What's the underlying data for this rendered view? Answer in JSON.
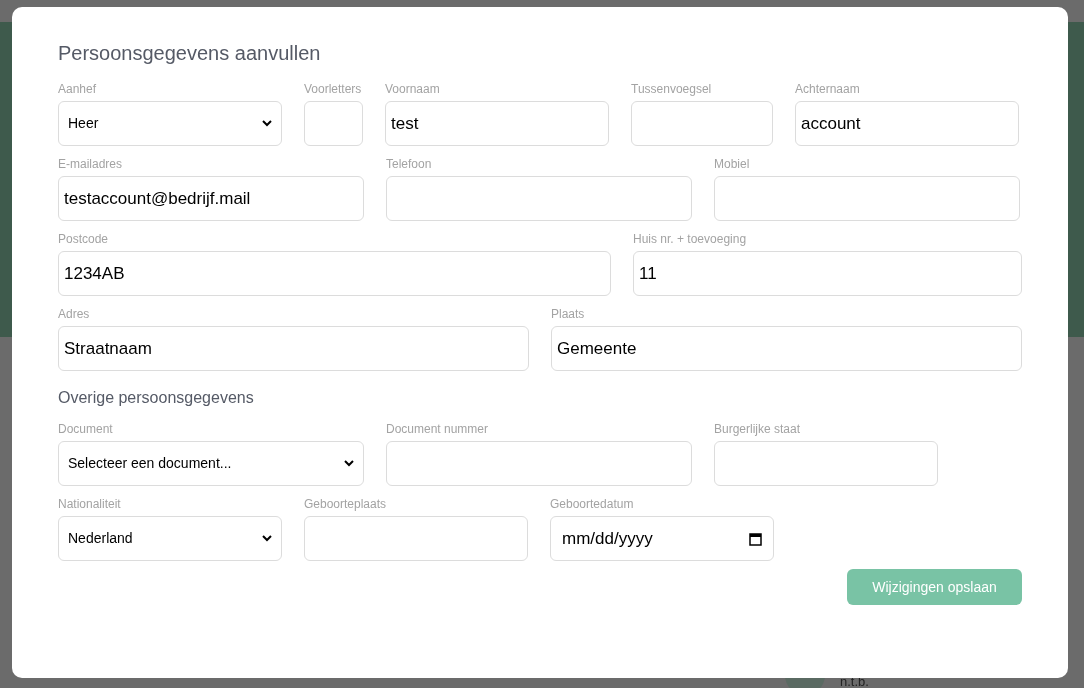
{
  "background": {
    "text": "n.t.b."
  },
  "dialog": {
    "title": "Persoonsgegevens aanvullen",
    "fields": [
      {
        "kind": "select",
        "label": "Aanhef",
        "value": "Heer"
      },
      {
        "kind": "text",
        "label": "Voorletters"
      },
      {
        "kind": "text",
        "label": "Voornaam",
        "value": "test"
      },
      {
        "kind": "text",
        "label": "Tussenvoegsel"
      },
      {
        "kind": "text",
        "label": "Achternaam",
        "value": "account"
      },
      {
        "kind": "text",
        "label": "E-mailadres",
        "value": "testaccount@bedrijf.mail"
      },
      {
        "kind": "text",
        "label": "Telefoon"
      },
      {
        "kind": "text",
        "label": "Mobiel"
      },
      {
        "kind": "text",
        "label": "Postcode",
        "value": "1234AB"
      },
      {
        "kind": "text",
        "label": "Huis nr. + toevoeging",
        "value": "11"
      },
      {
        "kind": "text",
        "label": "Adres",
        "value": "Straatnaam"
      },
      {
        "kind": "text",
        "label": "Plaats",
        "value": "Gemeente"
      }
    ],
    "subtitle": "Overige persoonsgegevens",
    "other_fields": [
      {
        "kind": "select",
        "label": "Document",
        "value": "Selecteer een document..."
      },
      {
        "kind": "text",
        "label": "Document nummer"
      },
      {
        "kind": "text",
        "label": "Burgerlijke staat"
      },
      {
        "kind": "select",
        "label": "Nationaliteit",
        "value": "Nederland"
      },
      {
        "kind": "text",
        "label": "Geboorteplaats"
      },
      {
        "kind": "date",
        "label": "Geboortedatum",
        "placeholder": "mm/dd/yyyy"
      }
    ],
    "save_button": "Wijzigingen opslaan"
  }
}
